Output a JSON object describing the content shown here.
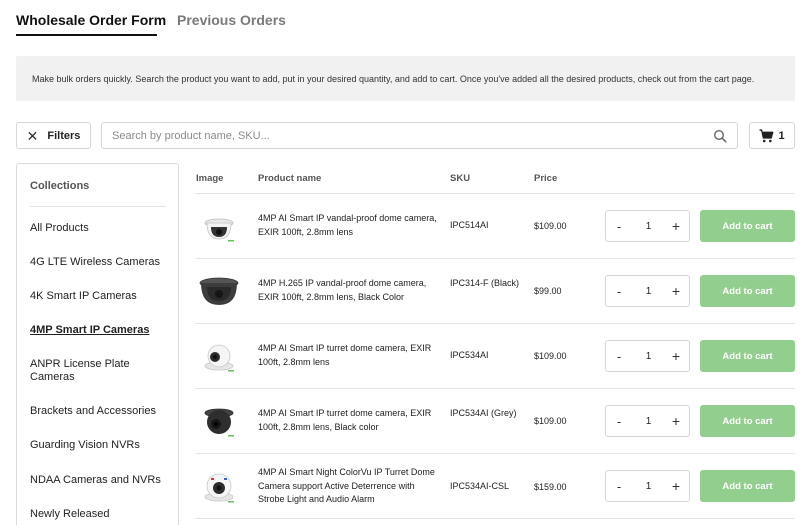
{
  "tabs": [
    {
      "label": "Wholesale Order Form",
      "active": true
    },
    {
      "label": "Previous Orders",
      "active": false
    }
  ],
  "info_banner": "Make bulk orders quickly. Search the product you want to add, put in your desired quantity, and add to cart. Once you've added all the desired products, check out from the cart page.",
  "toolbar": {
    "filters_label": "Filters",
    "search_placeholder": "Search by product name, SKU...",
    "cart_count": "1"
  },
  "sidebar": {
    "title": "Collections",
    "items": [
      {
        "label": "All Products",
        "active": false
      },
      {
        "label": "4G LTE Wireless Cameras",
        "active": false
      },
      {
        "label": "4K Smart IP Cameras",
        "active": false
      },
      {
        "label": "4MP Smart IP Cameras",
        "active": true
      },
      {
        "label": "ANPR License Plate Cameras",
        "active": false
      },
      {
        "label": "Brackets and Accessories",
        "active": false
      },
      {
        "label": "Guarding Vision NVRs",
        "active": false
      },
      {
        "label": "NDAA Cameras and NVRs",
        "active": false
      },
      {
        "label": "Newly Released",
        "active": false
      }
    ]
  },
  "table": {
    "headers": {
      "image": "Image",
      "product_name": "Product name",
      "sku": "SKU",
      "price": "Price"
    },
    "add_to_cart_label": "Add to cart",
    "minus_label": "-",
    "plus_label": "+",
    "rows": [
      {
        "name": "4MP AI Smart IP vandal-proof dome camera, EXIR 100ft, 2.8mm lens",
        "sku": "IPC514AI",
        "price": "$109.00",
        "qty": "1",
        "thumb": "dome-camera-white"
      },
      {
        "name": "4MP H.265 IP vandal-proof dome camera, EXIR 100ft, 2.8mm lens, Black Color",
        "sku": "IPC314-F (Black)",
        "price": "$99.00",
        "qty": "1",
        "thumb": "dome-camera-black"
      },
      {
        "name": "4MP AI Smart IP turret dome camera, EXIR 100ft, 2.8mm lens",
        "sku": "IPC534AI",
        "price": "$109.00",
        "qty": "1",
        "thumb": "turret-camera-white"
      },
      {
        "name": "4MP AI Smart IP turret dome camera, EXIR 100ft, 2.8mm lens, Black color",
        "sku": "IPC534AI (Grey)",
        "price": "$109.00",
        "qty": "1",
        "thumb": "turret-camera-black"
      },
      {
        "name": "4MP AI Smart Night ColorVu IP Turret Dome Camera support Active Deterrence with Strobe Light and Audio Alarm",
        "sku": "IPC534AI-CSL",
        "price": "$159.00",
        "qty": "1",
        "thumb": "colorvu-turret-camera"
      }
    ]
  },
  "colors": {
    "add_button": "#92cf8e",
    "banner": "#f1f1f1"
  }
}
